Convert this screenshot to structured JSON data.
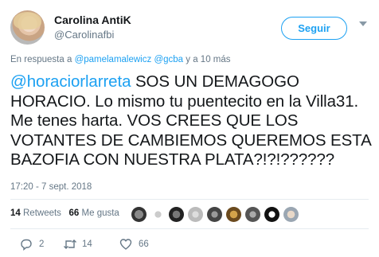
{
  "author": {
    "name": "Carolina AntiK",
    "handle": "@Carolinafbi"
  },
  "follow_button": "Seguir",
  "reply_context": {
    "prefix": "En respuesta a ",
    "mention1": "@pamelamalewicz",
    "mention2": "@gcba",
    "suffix": " y a 10 más"
  },
  "tweet": {
    "mention": "@horaciorlarreta",
    "text": " SOS UN DEMAGOGO HORACIO. Lo mismo tu puentecito en la Villa31. Me tenes harta. VOS CREES QUE LOS VOTANTES DE CAMBIEMOS QUEREMOS ESTA BAZOFIA CON NUESTRA PLATA?!?!??????"
  },
  "timestamp": "17:20 - 7 sept. 2018",
  "stats": {
    "retweets_count": "14",
    "retweets_label": " Retweets",
    "likes_count": "66",
    "likes_label": " Me gusta"
  },
  "actions": {
    "replies": "2",
    "retweets": "14",
    "likes": "66"
  },
  "colors": {
    "accent": "#1da1f2",
    "muted": "#657786",
    "text": "#14171a",
    "divider": "#e6ecf0"
  }
}
